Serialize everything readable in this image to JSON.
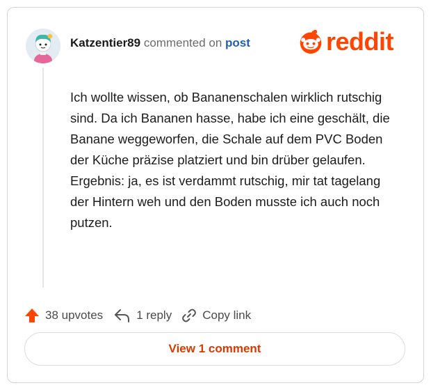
{
  "comment": {
    "username": "Katzentier89",
    "commented_on": "commented on",
    "post_link": "post",
    "body": [
      "Ich wollte wissen, ob Bananenschalen wirklich rutschig sind. Da ich Bananen hasse, habe ich eine geschält, die Banane weggeworfen, die Schale auf dem PVC Boden der Küche präzise platziert und bin drüber gelaufen.",
      "Ergebnis: ja, es ist verdammt rutschig, mir tat tagelang der Hintern weh und den Boden musste ich auch noch putzen."
    ]
  },
  "brand": {
    "wordmark": "reddit",
    "color": "#ff4500",
    "icon": "reddit-snoo-icon"
  },
  "actions": {
    "upvotes": "38 upvotes",
    "reply": "1 reply",
    "copy_link": "Copy link"
  },
  "icons": {
    "upvote": "upvote-arrow-icon",
    "reply": "reply-arrow-icon",
    "link": "link-icon"
  },
  "view_button": "View 1 comment",
  "colors": {
    "accent": "#d93a00",
    "upvote": "#ff4500",
    "link": "#1f5fb5"
  }
}
